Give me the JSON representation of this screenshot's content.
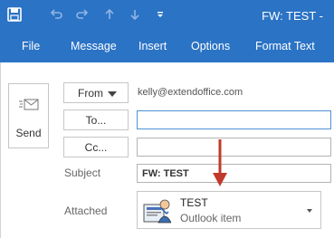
{
  "titlebar": {
    "title": "FW: TEST -",
    "icons": [
      "save-icon",
      "undo-icon",
      "redo-icon",
      "up-arrow-icon",
      "down-arrow-icon",
      "customize-quick-access-icon"
    ]
  },
  "ribbon": {
    "tabs": [
      "File",
      "Message",
      "Insert",
      "Options",
      "Format Text"
    ]
  },
  "compose": {
    "send_label": "Send",
    "from_label": "From",
    "from_value": "kelly@extendoffice.com",
    "to_label": "To...",
    "to_value": "",
    "cc_label": "Cc...",
    "cc_value": "",
    "subject_label": "Subject",
    "subject_value": "FW: TEST",
    "attached_label": "Attached",
    "attachment": {
      "name": "TEST",
      "type": "Outlook item"
    }
  },
  "colors": {
    "ribbon_blue": "#2b73c5",
    "arrow_red": "#c0392b"
  }
}
